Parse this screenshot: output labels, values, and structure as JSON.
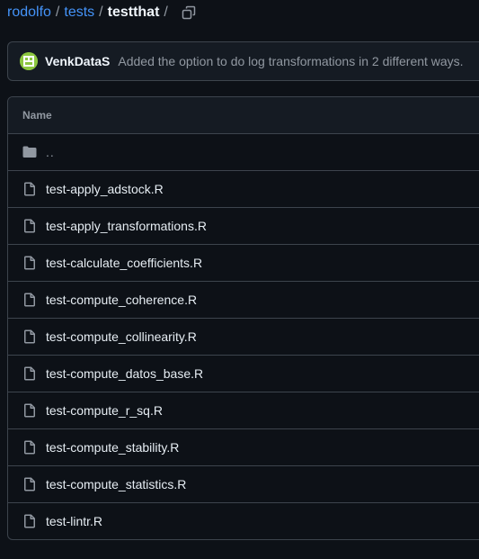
{
  "breadcrumb": {
    "owner": "rodolfo",
    "folder": "tests",
    "current": "testthat",
    "separator": "/"
  },
  "commit": {
    "author": "VenkDataS",
    "message": "Added the option to do log transformations in 2 different ways.",
    "avatar_color": "#8cc63f"
  },
  "table": {
    "header_name": "Name",
    "parent_dir": "..",
    "files": [
      "test-apply_adstock.R",
      "test-apply_transformations.R",
      "test-calculate_coefficients.R",
      "test-compute_coherence.R",
      "test-compute_collinearity.R",
      "test-compute_datos_base.R",
      "test-compute_r_sq.R",
      "test-compute_stability.R",
      "test-compute_statistics.R",
      "test-lintr.R"
    ]
  },
  "icons": {
    "copy": "copy-icon",
    "folder": "folder-icon",
    "file": "file-icon"
  },
  "colors": {
    "background": "#0d1117",
    "link": "#4493f8",
    "border": "#3d444d",
    "muted": "#9198a1"
  }
}
